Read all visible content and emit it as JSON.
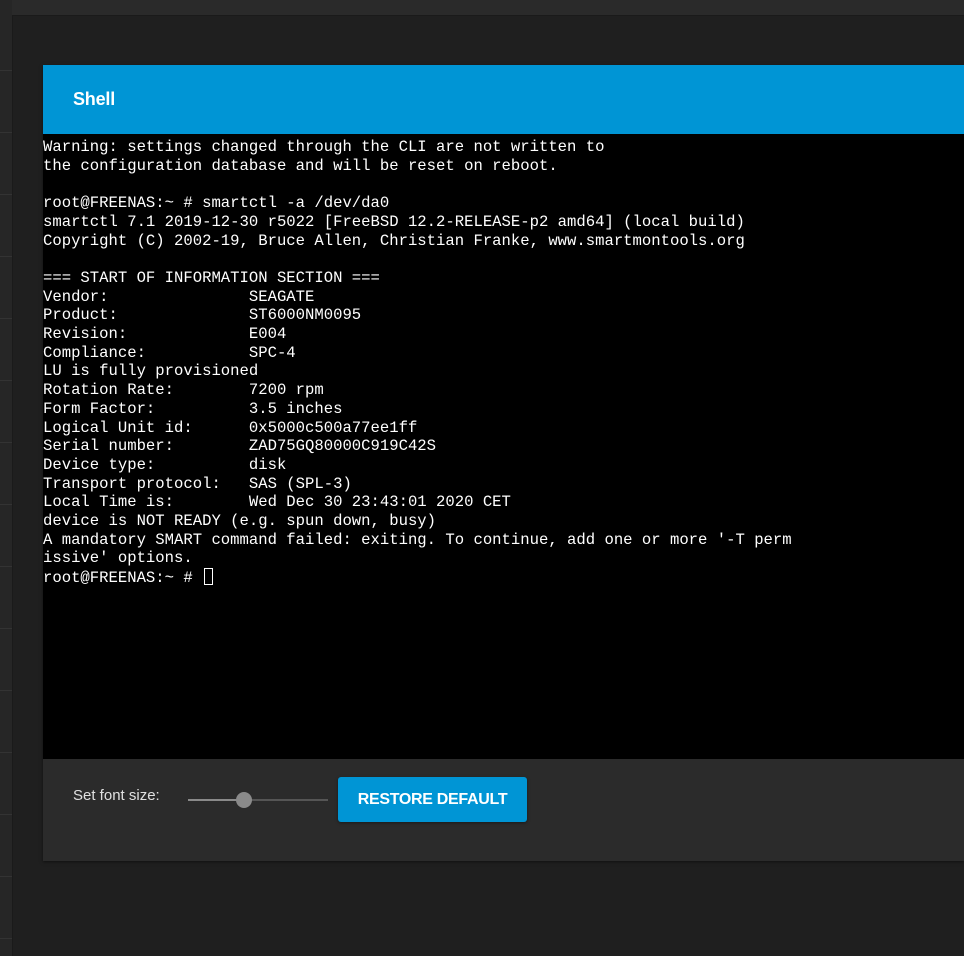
{
  "shell": {
    "title": "Shell"
  },
  "terminal": {
    "lines": [
      "Warning: settings changed through the CLI are not written to",
      "the configuration database and will be reset on reboot.",
      "",
      "root@FREENAS:~ # smartctl -a /dev/da0",
      "smartctl 7.1 2019-12-30 r5022 [FreeBSD 12.2-RELEASE-p2 amd64] (local build)",
      "Copyright (C) 2002-19, Bruce Allen, Christian Franke, www.smartmontools.org",
      "",
      "=== START OF INFORMATION SECTION ===",
      "Vendor:               SEAGATE",
      "Product:              ST6000NM0095",
      "Revision:             E004",
      "Compliance:           SPC-4",
      "LU is fully provisioned",
      "Rotation Rate:        7200 rpm",
      "Form Factor:          3.5 inches",
      "Logical Unit id:      0x5000c500a77ee1ff",
      "Serial number:        ZAD75GQ80000C919C42S",
      "Device type:          disk",
      "Transport protocol:   SAS (SPL-3)",
      "Local Time is:        Wed Dec 30 23:43:01 2020 CET",
      "device is NOT READY (e.g. spun down, busy)",
      "A mandatory SMART command failed: exiting. To continue, add one or more '-T perm",
      "issive' options."
    ],
    "prompt": "root@FREENAS:~ # "
  },
  "footer": {
    "font_size_label": "Set font size:",
    "font_size_fraction": 0.4,
    "restore_label": "RESTORE DEFAULT"
  },
  "colors": {
    "accent": "#0095d5",
    "terminal_bg": "#000000",
    "terminal_fg": "#ffffff",
    "page_bg": "#1f1f1f"
  }
}
